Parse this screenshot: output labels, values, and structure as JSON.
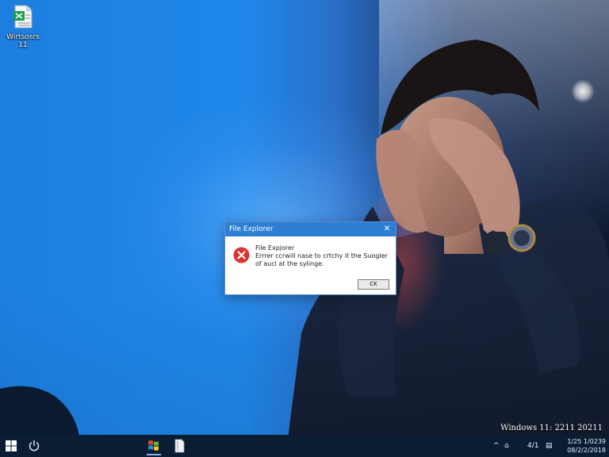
{
  "desktop": {
    "icon": {
      "label": "Wirtsosrs\n11",
      "icon": "spreadsheet-file-icon"
    },
    "watermark": "Windows 11: 2211 20211"
  },
  "dialog": {
    "title": "File Explorer",
    "close_glyph": "✕",
    "message_title": "File Expjorer",
    "message": "Errrer ccrwill nase to crtchy it the Suogler of aucl at the sylinge.",
    "ok_label": "CK",
    "error_icon": "error-x-icon",
    "title_color": "#2d7fd6",
    "error_color": "#e03030"
  },
  "taskbar": {
    "start_icon": "windows-logo-icon",
    "power_icon": "power-icon",
    "apps": [
      {
        "name": "windows-flag-app-icon",
        "active": true
      },
      {
        "name": "document-app-icon",
        "active": false
      }
    ],
    "tray": {
      "chevron": "^",
      "network_glyph": "⌂",
      "language": "4/1",
      "volume_glyph": "▤"
    },
    "clock": {
      "time": "1/25  1/0239",
      "date": "08/2/2/2018"
    }
  }
}
